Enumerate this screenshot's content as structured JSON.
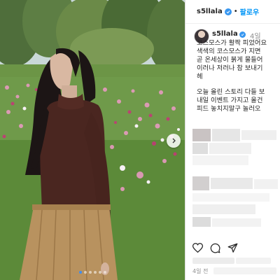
{
  "header": {
    "username": "s5llala",
    "separator": "•",
    "follow_label": "팔로우"
  },
  "caption": {
    "username": "s5llala",
    "time": "4일",
    "lines": [
      "코스모스가 활짝 피었어요",
      "색색의 코스모스가 지면",
      "곧 온세상이 붉게 물들어",
      "이러나 저러나 참 보내기",
      "헤",
      "",
      "오늘 올린 스토리 다들 보",
      "내일 이벤트 가지고 올건",
      "피드 놓치지말구 놀러오"
    ]
  },
  "carousel": {
    "dots": 6,
    "active_dot": 0
  },
  "footer": {
    "post_age": "4일 전"
  },
  "icons": {
    "verified": "verified-badge-icon",
    "next": "chevron-right-icon",
    "like": "heart-icon",
    "comment": "comment-icon",
    "share": "send-icon"
  },
  "colors": {
    "follow": "#0095f6",
    "verified": "#3897f0",
    "active_dot": "#3f8ef0"
  }
}
